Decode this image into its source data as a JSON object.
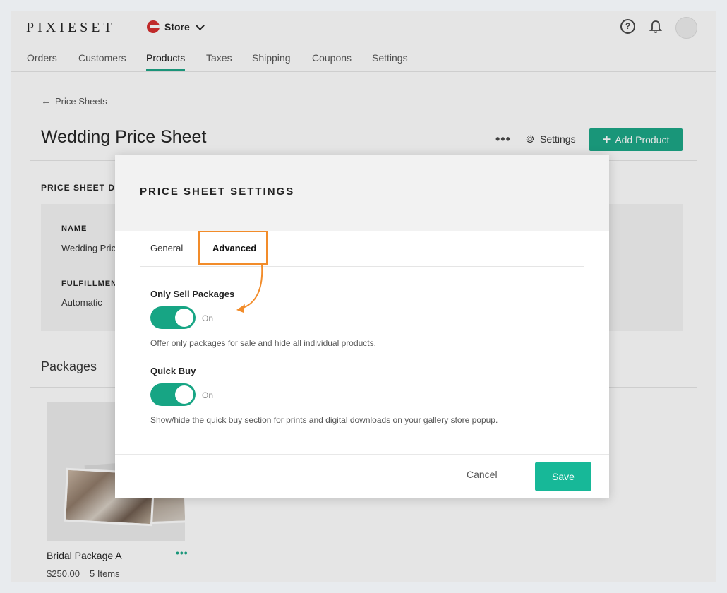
{
  "app": {
    "logo": "PIXIESET",
    "store_label": "Store"
  },
  "nav": {
    "items": [
      {
        "label": "Orders"
      },
      {
        "label": "Customers"
      },
      {
        "label": "Products",
        "active": true
      },
      {
        "label": "Taxes"
      },
      {
        "label": "Shipping"
      },
      {
        "label": "Coupons"
      },
      {
        "label": "Settings"
      }
    ]
  },
  "page": {
    "back_label": "Price Sheets",
    "title": "Wedding Price Sheet",
    "more_label": "•••",
    "settings_label": "Settings",
    "add_product_label": "Add Product",
    "section_label": "PRICE SHEET D",
    "details": {
      "name_label": "NAME",
      "name_value": "Wedding Pric",
      "fulfillment_label": "FULFILLMEN",
      "fulfillment_value": "Automatic"
    },
    "packages_title": "Packages",
    "package": {
      "name": "Bridal Package A",
      "price": "$250.00",
      "items": "5 Items",
      "menu": "•••"
    }
  },
  "modal": {
    "title": "PRICE SHEET SETTINGS",
    "tabs": [
      {
        "label": "General"
      },
      {
        "label": "Advanced",
        "active": true
      }
    ],
    "options": [
      {
        "title": "Only Sell Packages",
        "state": "On",
        "enabled": true,
        "description": "Offer only packages for sale and hide all individual products."
      },
      {
        "title": "Quick Buy",
        "state": "On",
        "enabled": true,
        "description": "Show/hide the quick buy section for prints and digital downloads on your gallery store popup."
      }
    ],
    "cancel_label": "Cancel",
    "save_label": "Save"
  },
  "colors": {
    "accent": "#17a584",
    "highlight": "#f28c2a",
    "brand_red": "#d52b2b"
  }
}
